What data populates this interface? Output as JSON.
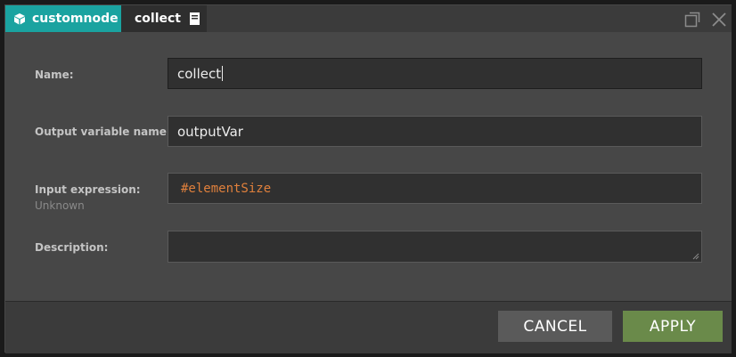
{
  "titlebar": {
    "type_tab_label": "customnode",
    "name_tab_label": "collect",
    "icons": {
      "type": "cube-icon",
      "doc": "document-icon",
      "maximize": "maximize-icon",
      "close": "close-icon"
    },
    "type_tab_color": "#1aa3a0"
  },
  "form": {
    "name": {
      "label": "Name:",
      "value": "collect"
    },
    "output_variable": {
      "label": "Output variable name:",
      "value": "outputVar"
    },
    "input_expression": {
      "label": "Input expression:",
      "sublabel": "Unknown",
      "value": "#elementSize",
      "value_color": "#e0803c"
    },
    "description": {
      "label": "Description:",
      "value": ""
    }
  },
  "footer": {
    "cancel_label": "CANCEL",
    "apply_label": "APPLY",
    "apply_color": "#6a8a4a"
  }
}
